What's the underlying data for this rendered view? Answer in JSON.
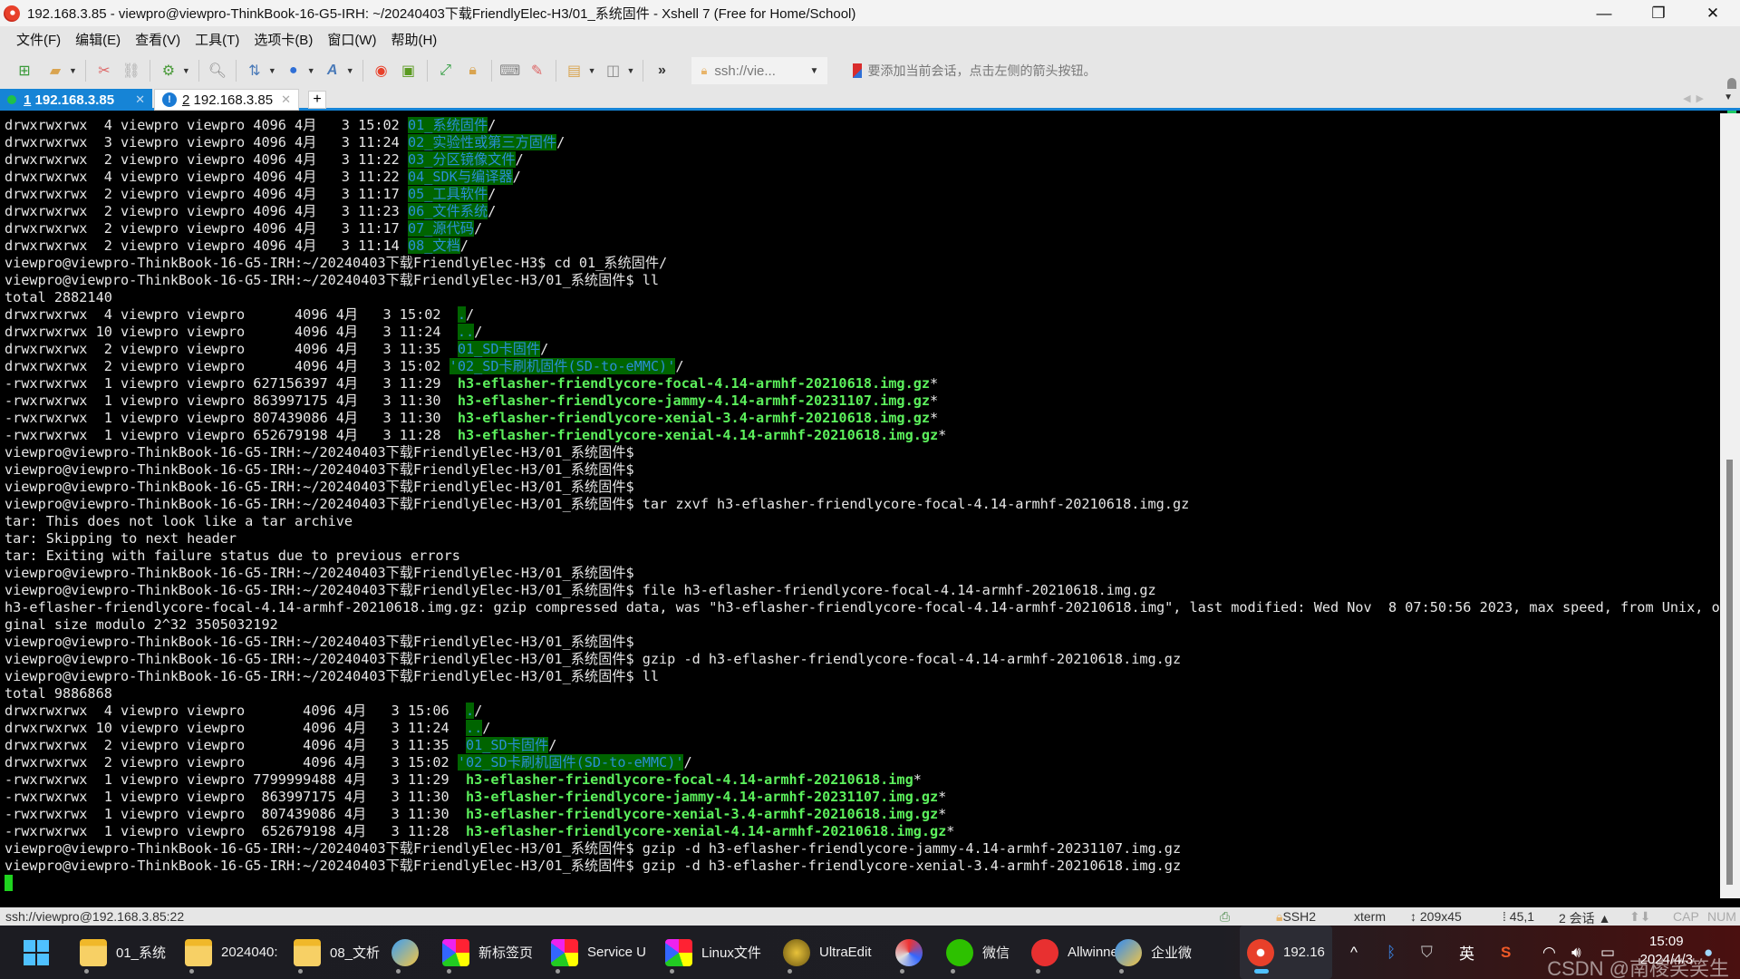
{
  "window": {
    "title": "192.168.3.85 - viewpro@viewpro-ThinkBook-16-G5-IRH: ~/20240403下载FriendlyElec-H3/01_系统固件 - Xshell 7 (Free for Home/School)",
    "controls": {
      "minimize": "—",
      "restore": "❐",
      "close": "✕"
    }
  },
  "menu": [
    "文件(F)",
    "编辑(E)",
    "查看(V)",
    "工具(T)",
    "选项卡(B)",
    "窗口(W)",
    "帮助(H)"
  ],
  "toolbar": {
    "icons": [
      "new-session-icon",
      "open-folder-icon",
      "disconnect-icon",
      "reconnect-icon",
      "properties-icon",
      "find-icon",
      "transfer-icon",
      "globe-icon",
      "font-icon",
      "xshell-icon",
      "xftp-icon",
      "fullscreen-icon",
      "lock-icon",
      "keyboard-icon",
      "highlight-icon",
      "new-tab-folder-icon",
      "layout-icon",
      "more-icon"
    ],
    "address": "ssh://vie...",
    "hint": "要添加当前会话，点击左侧的箭头按钮。"
  },
  "tabs": [
    {
      "number": "1",
      "label": "192.168.3.85",
      "active": true
    },
    {
      "number": "2",
      "label": "192.168.3.85",
      "active": false
    }
  ],
  "terminal": {
    "lines": [
      [
        {
          "t": "drwxrwxrwx  4 viewpro viewpro 4096 4月   3 15:02 "
        },
        {
          "t": "01_系统固件",
          "c": "dir"
        },
        {
          "t": "/"
        }
      ],
      [
        {
          "t": "drwxrwxrwx  3 viewpro viewpro 4096 4月   3 11:24 "
        },
        {
          "t": "02_实验性或第三方固件",
          "c": "dir"
        },
        {
          "t": "/"
        }
      ],
      [
        {
          "t": "drwxrwxrwx  2 viewpro viewpro 4096 4月   3 11:22 "
        },
        {
          "t": "03_分区镜像文件",
          "c": "dir"
        },
        {
          "t": "/"
        }
      ],
      [
        {
          "t": "drwxrwxrwx  4 viewpro viewpro 4096 4月   3 11:22 "
        },
        {
          "t": "04_SDK与编译器",
          "c": "dir"
        },
        {
          "t": "/"
        }
      ],
      [
        {
          "t": "drwxrwxrwx  2 viewpro viewpro 4096 4月   3 11:17 "
        },
        {
          "t": "05_工具软件",
          "c": "dir"
        },
        {
          "t": "/"
        }
      ],
      [
        {
          "t": "drwxrwxrwx  2 viewpro viewpro 4096 4月   3 11:23 "
        },
        {
          "t": "06_文件系统",
          "c": "dir"
        },
        {
          "t": "/"
        }
      ],
      [
        {
          "t": "drwxrwxrwx  2 viewpro viewpro 4096 4月   3 11:17 "
        },
        {
          "t": "07_源代码",
          "c": "dir"
        },
        {
          "t": "/"
        }
      ],
      [
        {
          "t": "drwxrwxrwx  2 viewpro viewpro 4096 4月   3 11:14 "
        },
        {
          "t": "08_文档",
          "c": "dir"
        },
        {
          "t": "/"
        }
      ],
      [
        {
          "t": "viewpro@viewpro-ThinkBook-16-G5-IRH:~/20240403下载FriendlyElec-H3$ cd 01_系统固件/"
        }
      ],
      [
        {
          "t": "viewpro@viewpro-ThinkBook-16-G5-IRH:~/20240403下载FriendlyElec-H3/01_系统固件$ ll"
        }
      ],
      [
        {
          "t": "total 2882140"
        }
      ],
      [
        {
          "t": "drwxrwxrwx  4 viewpro viewpro      4096 4月   3 15:02  "
        },
        {
          "t": ".",
          "c": "dir"
        },
        {
          "t": "/"
        }
      ],
      [
        {
          "t": "drwxrwxrwx 10 viewpro viewpro      4096 4月   3 11:24  "
        },
        {
          "t": "..",
          "c": "dir"
        },
        {
          "t": "/"
        }
      ],
      [
        {
          "t": "drwxrwxrwx  2 viewpro viewpro      4096 4月   3 11:35  "
        },
        {
          "t": "01_SD卡固件",
          "c": "dir"
        },
        {
          "t": "/"
        }
      ],
      [
        {
          "t": "drwxrwxrwx  2 viewpro viewpro      4096 4月   3 15:02 "
        },
        {
          "t": "'02_SD卡刷机固件(SD-to-eMMC)'",
          "c": "dir"
        },
        {
          "t": "/"
        }
      ],
      [
        {
          "t": "-rwxrwxrwx  1 viewpro viewpro 627156397 4月   3 11:29  "
        },
        {
          "t": "h3-eflasher-friendlycore-focal-4.14-armhf-20210618.img.gz",
          "c": "exe"
        },
        {
          "t": "*"
        }
      ],
      [
        {
          "t": "-rwxrwxrwx  1 viewpro viewpro 863997175 4月   3 11:30  "
        },
        {
          "t": "h3-eflasher-friendlycore-jammy-4.14-armhf-20231107.img.gz",
          "c": "exe"
        },
        {
          "t": "*"
        }
      ],
      [
        {
          "t": "-rwxrwxrwx  1 viewpro viewpro 807439086 4月   3 11:30  "
        },
        {
          "t": "h3-eflasher-friendlycore-xenial-3.4-armhf-20210618.img.gz",
          "c": "exe"
        },
        {
          "t": "*"
        }
      ],
      [
        {
          "t": "-rwxrwxrwx  1 viewpro viewpro 652679198 4月   3 11:28  "
        },
        {
          "t": "h3-eflasher-friendlycore-xenial-4.14-armhf-20210618.img.gz",
          "c": "exe"
        },
        {
          "t": "*"
        }
      ],
      [
        {
          "t": "viewpro@viewpro-ThinkBook-16-G5-IRH:~/20240403下载FriendlyElec-H3/01_系统固件$"
        }
      ],
      [
        {
          "t": "viewpro@viewpro-ThinkBook-16-G5-IRH:~/20240403下载FriendlyElec-H3/01_系统固件$"
        }
      ],
      [
        {
          "t": "viewpro@viewpro-ThinkBook-16-G5-IRH:~/20240403下载FriendlyElec-H3/01_系统固件$"
        }
      ],
      [
        {
          "t": "viewpro@viewpro-ThinkBook-16-G5-IRH:~/20240403下载FriendlyElec-H3/01_系统固件$ tar zxvf h3-eflasher-friendlycore-focal-4.14-armhf-20210618.img.gz"
        }
      ],
      [
        {
          "t": "tar: This does not look like a tar archive"
        }
      ],
      [
        {
          "t": "tar: Skipping to next header"
        }
      ],
      [
        {
          "t": "tar: Exiting with failure status due to previous errors"
        }
      ],
      [
        {
          "t": "viewpro@viewpro-ThinkBook-16-G5-IRH:~/20240403下载FriendlyElec-H3/01_系统固件$"
        }
      ],
      [
        {
          "t": "viewpro@viewpro-ThinkBook-16-G5-IRH:~/20240403下载FriendlyElec-H3/01_系统固件$ file h3-eflasher-friendlycore-focal-4.14-armhf-20210618.img.gz"
        }
      ],
      [
        {
          "t": "h3-eflasher-friendlycore-focal-4.14-armhf-20210618.img.gz: gzip compressed data, was \"h3-eflasher-friendlycore-focal-4.14-armhf-20210618.img\", last modified: Wed Nov  8 07:50:56 2023, max speed, from Unix, ori"
        }
      ],
      [
        {
          "t": "ginal size modulo 2^32 3505032192"
        }
      ],
      [
        {
          "t": "viewpro@viewpro-ThinkBook-16-G5-IRH:~/20240403下载FriendlyElec-H3/01_系统固件$"
        }
      ],
      [
        {
          "t": "viewpro@viewpro-ThinkBook-16-G5-IRH:~/20240403下载FriendlyElec-H3/01_系统固件$ gzip -d h3-eflasher-friendlycore-focal-4.14-armhf-20210618.img.gz"
        }
      ],
      [
        {
          "t": "viewpro@viewpro-ThinkBook-16-G5-IRH:~/20240403下载FriendlyElec-H3/01_系统固件$ ll"
        }
      ],
      [
        {
          "t": "total 9886868"
        }
      ],
      [
        {
          "t": "drwxrwxrwx  4 viewpro viewpro       4096 4月   3 15:06  "
        },
        {
          "t": ".",
          "c": "dir"
        },
        {
          "t": "/"
        }
      ],
      [
        {
          "t": "drwxrwxrwx 10 viewpro viewpro       4096 4月   3 11:24  "
        },
        {
          "t": "..",
          "c": "dir"
        },
        {
          "t": "/"
        }
      ],
      [
        {
          "t": "drwxrwxrwx  2 viewpro viewpro       4096 4月   3 11:35  "
        },
        {
          "t": "01_SD卡固件",
          "c": "dir"
        },
        {
          "t": "/"
        }
      ],
      [
        {
          "t": "drwxrwxrwx  2 viewpro viewpro       4096 4月   3 15:02 "
        },
        {
          "t": "'02_SD卡刷机固件(SD-to-eMMC)'",
          "c": "dir"
        },
        {
          "t": "/"
        }
      ],
      [
        {
          "t": "-rwxrwxrwx  1 viewpro viewpro 7799999488 4月   3 11:29  "
        },
        {
          "t": "h3-eflasher-friendlycore-focal-4.14-armhf-20210618.img",
          "c": "exe"
        },
        {
          "t": "*"
        }
      ],
      [
        {
          "t": "-rwxrwxrwx  1 viewpro viewpro  863997175 4月   3 11:30  "
        },
        {
          "t": "h3-eflasher-friendlycore-jammy-4.14-armhf-20231107.img.gz",
          "c": "exe"
        },
        {
          "t": "*"
        }
      ],
      [
        {
          "t": "-rwxrwxrwx  1 viewpro viewpro  807439086 4月   3 11:30  "
        },
        {
          "t": "h3-eflasher-friendlycore-xenial-3.4-armhf-20210618.img.gz",
          "c": "exe"
        },
        {
          "t": "*"
        }
      ],
      [
        {
          "t": "-rwxrwxrwx  1 viewpro viewpro  652679198 4月   3 11:28  "
        },
        {
          "t": "h3-eflasher-friendlycore-xenial-4.14-armhf-20210618.img.gz",
          "c": "exe"
        },
        {
          "t": "*"
        }
      ],
      [
        {
          "t": "viewpro@viewpro-ThinkBook-16-G5-IRH:~/20240403下载FriendlyElec-H3/01_系统固件$ gzip -d h3-eflasher-friendlycore-jammy-4.14-armhf-20231107.img.gz"
        }
      ],
      [
        {
          "t": "viewpro@viewpro-ThinkBook-16-G5-IRH:~/20240403下载FriendlyElec-H3/01_系统固件$ gzip -d h3-eflasher-friendlycore-xenial-3.4-armhf-20210618.img.gz"
        }
      ],
      [
        {
          "t": "",
          "cursor": true
        }
      ]
    ]
  },
  "statusbar": {
    "connection": "ssh://viewpro@192.168.3.85:22",
    "protocol": "SSH2",
    "term_type": "xterm",
    "size": "209x45",
    "cursor_pos": "45,1",
    "sessions": "2 会话",
    "cap": "CAP",
    "num": "NUM"
  },
  "taskbar": {
    "apps": [
      {
        "label": "01_系统",
        "icon": "folder-icon"
      },
      {
        "label": "2024040:",
        "icon": "folder-icon"
      },
      {
        "label": "08_文析",
        "icon": "folder-icon"
      },
      {
        "label": "",
        "icon": "paint-icon"
      },
      {
        "label": "新标签页",
        "icon": "chrome-icon"
      },
      {
        "label": "Service U",
        "icon": "chrome-icon"
      },
      {
        "label": "Linux文件",
        "icon": "chrome-icon"
      },
      {
        "label": "UltraEdit",
        "icon": "ultraedit-icon"
      },
      {
        "label": "",
        "icon": "sync-icon"
      },
      {
        "label": "微信",
        "icon": "wechat-icon"
      },
      {
        "label": "Allwinner",
        "icon": "wps-icon"
      },
      {
        "label": "企业微",
        "icon": "wecom-icon"
      },
      {
        "label": "192.16",
        "icon": "xshell-icon"
      }
    ],
    "tray": {
      "ime": "英",
      "time": "15:09",
      "date": "2024/4/3"
    },
    "watermark": "CSDN @南棱笑笑生"
  }
}
